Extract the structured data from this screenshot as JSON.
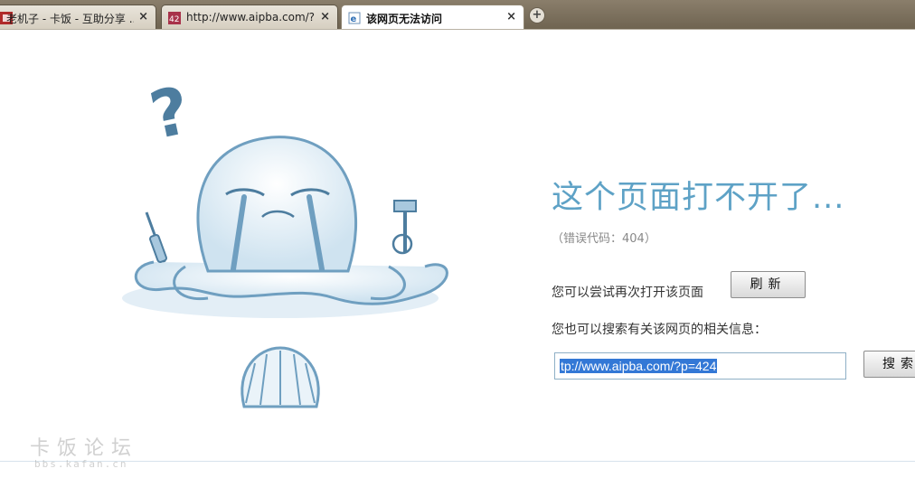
{
  "tabs": [
    {
      "title": "老机子 - 卡饭 - 互助分享 ...",
      "close": "×",
      "active": false
    },
    {
      "title": "http://www.aipba.com/?...",
      "close": "×",
      "active": false
    },
    {
      "title": "该网页无法访问",
      "close": "×",
      "active": true
    }
  ],
  "new_tab": "+",
  "error": {
    "heading": "这个页面打不开了...",
    "code": "（错误代码：404）",
    "retry_text": "您可以尝试再次打开该页面",
    "refresh_button": "刷新",
    "search_prompt": "您也可以搜索有关该网页的相关信息：",
    "search_value": "tp://www.aipba.com/?p=424",
    "search_button": "搜索"
  },
  "watermark": {
    "brand": "卡饭论坛",
    "url": "bbs.kafan.cn"
  },
  "colors": {
    "heading": "#5ea2c6",
    "illustration": "#6f9fc0",
    "selection": "#3378d6"
  },
  "icons": {
    "tab1": "kafan-favicon",
    "tab2": "aipba-favicon",
    "tab3": "ie-page-icon",
    "illustration": "crying-octopus"
  }
}
